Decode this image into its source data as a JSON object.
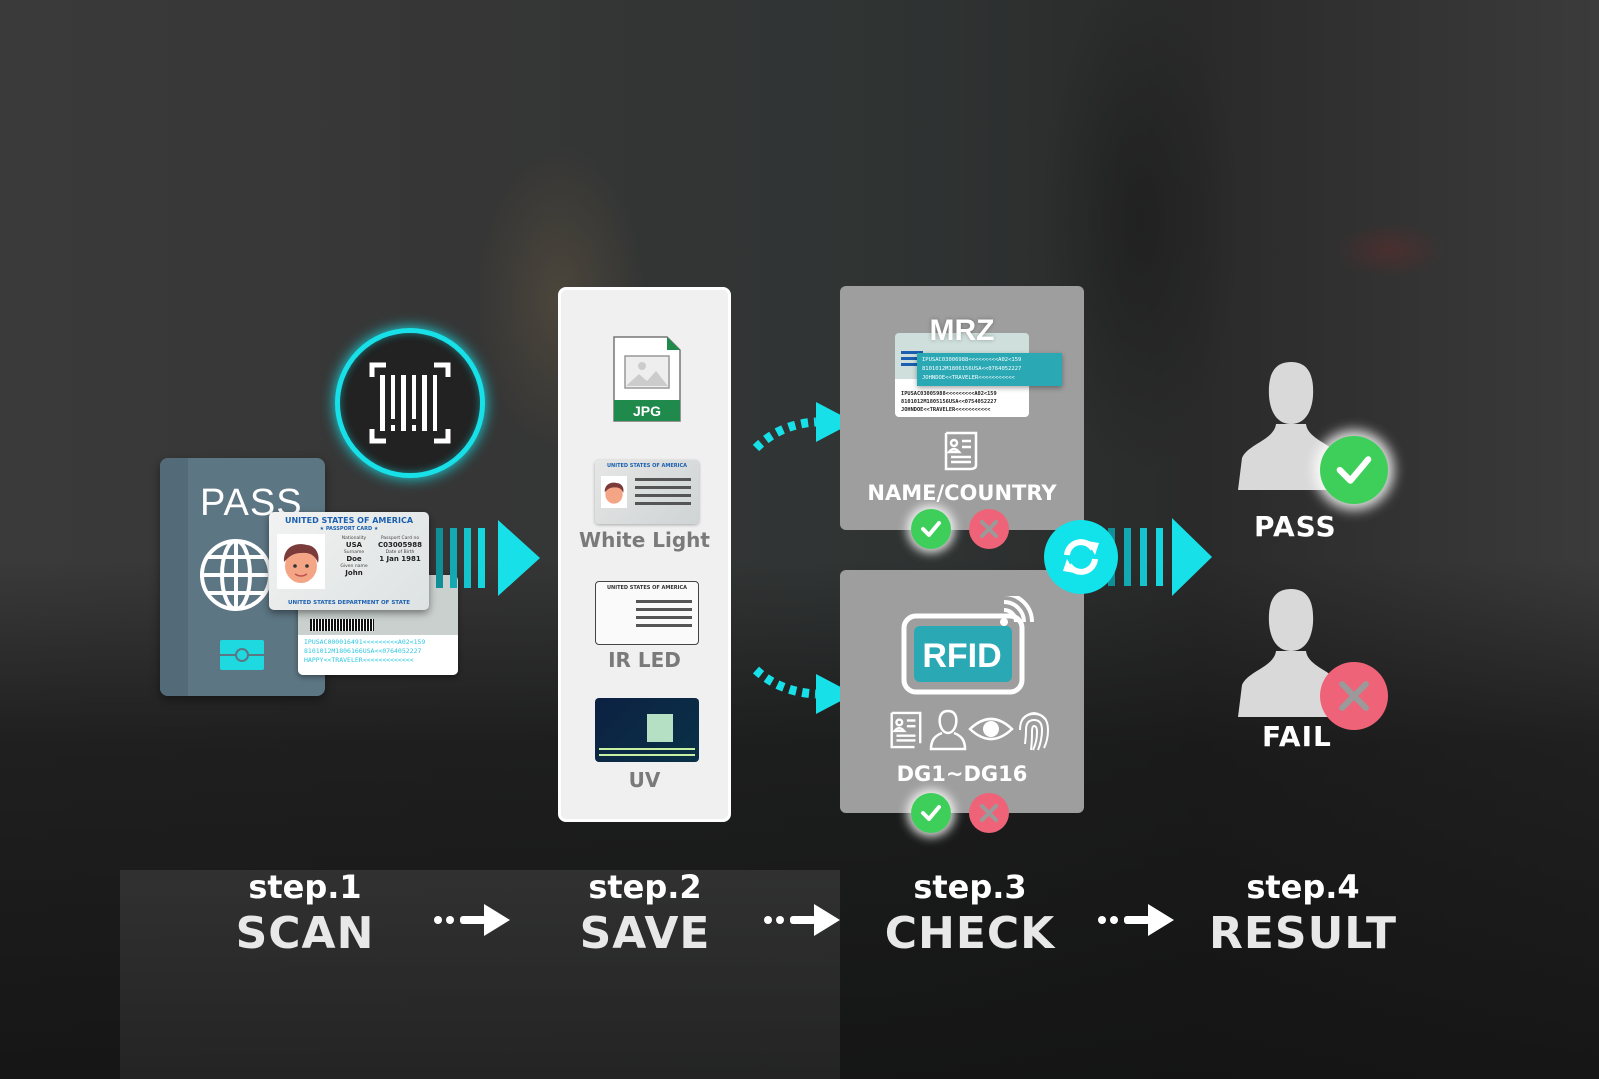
{
  "colors": {
    "accent": "#18e0e8",
    "pass_green": "#3ecf5a",
    "fail_red": "#ef6379",
    "panel_gray": "#9e9e9e",
    "jpg_green": "#1f8a4c",
    "rfid_teal": "#2aa9b5"
  },
  "step1": {
    "scan_icon": "barcode-scan-icon",
    "passport_label": "PASS",
    "passport_icon": "globe-icon",
    "card": {
      "title": "UNITED STATES OF AMERICA",
      "subtitle": "★ PASSPORT CARD ★",
      "fields": [
        {
          "label": "Nationality",
          "value": "USA"
        },
        {
          "label": "Passport Card no",
          "value": "C03005988"
        },
        {
          "label": "Surname",
          "value": "Doe"
        },
        {
          "label": "Date of Birth",
          "value": "1 Jan 1981"
        },
        {
          "label": "Given name",
          "value": "John"
        }
      ],
      "footer": "UNITED STATES DEPARTMENT OF STATE"
    },
    "card_back_mrz": [
      "IPUSAC000016491<<<<<<<<<A02<159",
      "8101012M1806166USA<<0764052227",
      "HAPPY<<TRAVELER<<<<<<<<<<<<<"
    ]
  },
  "step2": {
    "file_type": "JPG",
    "items": [
      {
        "label": "White Light",
        "card_title": "UNITED STATES OF AMERICA"
      },
      {
        "label": "IR LED",
        "card_title": "UNITED STATES OF AMERICA"
      },
      {
        "label": "UV",
        "card_title": ""
      }
    ]
  },
  "step3": {
    "mrz": {
      "title": "MRZ",
      "strip_lines": [
        "IPUSAC03006988<<<<<<<<<A02<159",
        "8101012M1806156USA<<0764052227",
        "JOHNDOE<<TRAVELER<<<<<<<<<<<"
      ],
      "card_lines": [
        "IPUSAC03005988<<<<<<<<<A02<159",
        "8101012M1805156USA<<0754052227",
        "JOHNDOE<<TRAVELER<<<<<<<<<<<"
      ],
      "label": "NAME/COUNTRY"
    },
    "rfid": {
      "title": "RFID",
      "icons": [
        "document-icon",
        "person-icon",
        "eye-icon",
        "fingerprint-icon"
      ],
      "label": "DG1~DG16"
    }
  },
  "step4": {
    "pass_label": "PASS",
    "fail_label": "FAIL"
  },
  "steps": [
    {
      "num": "step.1",
      "name": "SCAN"
    },
    {
      "num": "step.2",
      "name": "SAVE"
    },
    {
      "num": "step.3",
      "name": "CHECK"
    },
    {
      "num": "step.4",
      "name": "RESULT"
    }
  ]
}
